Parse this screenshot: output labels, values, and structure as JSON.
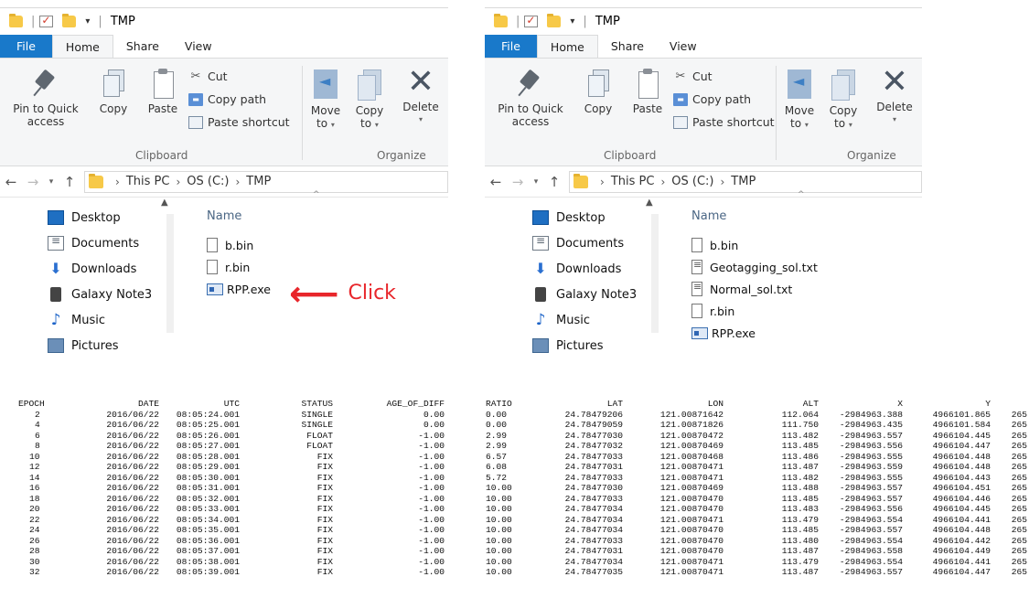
{
  "windows": [
    {
      "id": "left",
      "title": "TMP",
      "tabs": [
        "File",
        "Home",
        "Share",
        "View"
      ],
      "ribbon": {
        "pin_label_1": "Pin to Quick",
        "pin_label_2": "access",
        "copy": "Copy",
        "paste": "Paste",
        "cut": "Cut",
        "copy_path": "Copy path",
        "paste_shortcut": "Paste shortcut",
        "move_to_1": "Move",
        "move_to_2": "to",
        "copy_to_1": "Copy",
        "copy_to_2": "to",
        "delete": "Delete",
        "clipboard_group": "Clipboard",
        "organize_group": "Organize"
      },
      "breadcrumb": [
        "This PC",
        "OS (C:)",
        "TMP"
      ],
      "nav_items": [
        "Desktop",
        "Documents",
        "Downloads",
        "Galaxy Note3",
        "Music",
        "Pictures"
      ],
      "column_name": "Name",
      "files": [
        {
          "name": "b.bin",
          "type": "bin"
        },
        {
          "name": "r.bin",
          "type": "bin"
        },
        {
          "name": "RPP.exe",
          "type": "exe"
        }
      ]
    },
    {
      "id": "right",
      "title": "TMP",
      "tabs": [
        "File",
        "Home",
        "Share",
        "View"
      ],
      "ribbon": {
        "pin_label_1": "Pin to Quick",
        "pin_label_2": "access",
        "copy": "Copy",
        "paste": "Paste",
        "cut": "Cut",
        "copy_path": "Copy path",
        "paste_shortcut": "Paste shortcut",
        "move_to_1": "Move",
        "move_to_2": "to",
        "copy_to_1": "Copy",
        "copy_to_2": "to",
        "delete": "Delete",
        "clipboard_group": "Clipboard",
        "organize_group": "Organize"
      },
      "breadcrumb": [
        "This PC",
        "OS (C:)",
        "TMP"
      ],
      "nav_items": [
        "Desktop",
        "Documents",
        "Downloads",
        "Galaxy Note3",
        "Music",
        "Pictures"
      ],
      "column_name": "Name",
      "files": [
        {
          "name": "b.bin",
          "type": "bin"
        },
        {
          "name": "Geotagging_sol.txt",
          "type": "txt"
        },
        {
          "name": "Normal_sol.txt",
          "type": "txt"
        },
        {
          "name": "r.bin",
          "type": "bin"
        },
        {
          "name": "RPP.exe",
          "type": "exe"
        }
      ]
    }
  ],
  "annotation": {
    "text": "Click",
    "color": "#e8262b"
  },
  "colors": {
    "file_tab": "#1979ca",
    "ribbon_bg": "#f5f6f7",
    "name_header": "#4a6684"
  },
  "output": {
    "headers_left": [
      "EPOCH",
      "DATE",
      "UTC",
      "STATUS",
      "AGE_OF_DIFF"
    ],
    "headers_right": [
      "RATIO",
      "LAT",
      "LON",
      "ALT",
      "X",
      "Y",
      ""
    ],
    "rows": [
      [
        "2",
        "2016/06/22",
        "08:05:24.001",
        "SINGLE",
        "0.00",
        "0.00",
        "24.78479206",
        "121.00871642",
        "112.064",
        "-2984963.388",
        "4966101.865",
        "265"
      ],
      [
        "4",
        "2016/06/22",
        "08:05:25.001",
        "SINGLE",
        "0.00",
        "0.00",
        "24.78479059",
        "121.00871826",
        "111.750",
        "-2984963.435",
        "4966101.584",
        "265"
      ],
      [
        "6",
        "2016/06/22",
        "08:05:26.001",
        "FLOAT",
        "-1.00",
        "2.99",
        "24.78477030",
        "121.00870472",
        "113.482",
        "-2984963.557",
        "4966104.445",
        "265"
      ],
      [
        "8",
        "2016/06/22",
        "08:05:27.001",
        "FLOAT",
        "-1.00",
        "2.99",
        "24.78477032",
        "121.00870469",
        "113.485",
        "-2984963.556",
        "4966104.447",
        "265"
      ],
      [
        "10",
        "2016/06/22",
        "08:05:28.001",
        "FIX",
        "-1.00",
        "6.57",
        "24.78477033",
        "121.00870468",
        "113.486",
        "-2984963.555",
        "4966104.448",
        "265"
      ],
      [
        "12",
        "2016/06/22",
        "08:05:29.001",
        "FIX",
        "-1.00",
        "6.08",
        "24.78477031",
        "121.00870471",
        "113.487",
        "-2984963.559",
        "4966104.448",
        "265"
      ],
      [
        "14",
        "2016/06/22",
        "08:05:30.001",
        "FIX",
        "-1.00",
        "5.72",
        "24.78477033",
        "121.00870471",
        "113.482",
        "-2984963.555",
        "4966104.443",
        "265"
      ],
      [
        "16",
        "2016/06/22",
        "08:05:31.001",
        "FIX",
        "-1.00",
        "10.00",
        "24.78477030",
        "121.00870469",
        "113.488",
        "-2984963.557",
        "4966104.451",
        "265"
      ],
      [
        "18",
        "2016/06/22",
        "08:05:32.001",
        "FIX",
        "-1.00",
        "10.00",
        "24.78477033",
        "121.00870470",
        "113.485",
        "-2984963.557",
        "4966104.446",
        "265"
      ],
      [
        "20",
        "2016/06/22",
        "08:05:33.001",
        "FIX",
        "-1.00",
        "10.00",
        "24.78477034",
        "121.00870470",
        "113.483",
        "-2984963.556",
        "4966104.445",
        "265"
      ],
      [
        "22",
        "2016/06/22",
        "08:05:34.001",
        "FIX",
        "-1.00",
        "10.00",
        "24.78477034",
        "121.00870471",
        "113.479",
        "-2984963.554",
        "4966104.441",
        "265"
      ],
      [
        "24",
        "2016/06/22",
        "08:05:35.001",
        "FIX",
        "-1.00",
        "10.00",
        "24.78477034",
        "121.00870470",
        "113.485",
        "-2984963.557",
        "4966104.448",
        "265"
      ],
      [
        "26",
        "2016/06/22",
        "08:05:36.001",
        "FIX",
        "-1.00",
        "10.00",
        "24.78477033",
        "121.00870470",
        "113.480",
        "-2984963.554",
        "4966104.442",
        "265"
      ],
      [
        "28",
        "2016/06/22",
        "08:05:37.001",
        "FIX",
        "-1.00",
        "10.00",
        "24.78477031",
        "121.00870470",
        "113.487",
        "-2984963.558",
        "4966104.449",
        "265"
      ],
      [
        "30",
        "2016/06/22",
        "08:05:38.001",
        "FIX",
        "-1.00",
        "10.00",
        "24.78477034",
        "121.00870471",
        "113.479",
        "-2984963.554",
        "4966104.441",
        "265"
      ],
      [
        "32",
        "2016/06/22",
        "08:05:39.001",
        "FIX",
        "-1.00",
        "10.00",
        "24.78477035",
        "121.00870471",
        "113.487",
        "-2984963.557",
        "4966104.447",
        "265"
      ]
    ]
  }
}
